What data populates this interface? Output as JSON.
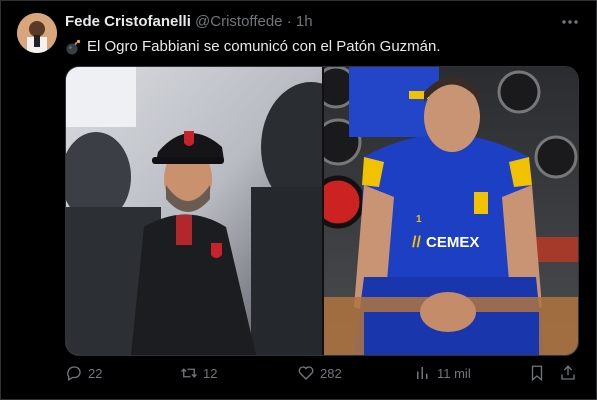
{
  "tweet": {
    "author_name": "Fede Cristofanelli",
    "handle": "@Cristoffede",
    "separator": "·",
    "time": "1h",
    "text": "El Ogro Fabbiani se comunicó con el Patón Guzmán.",
    "emoji_icon": "bomb-icon"
  },
  "media": {
    "left_jersey_text": "",
    "right_sponsor_text": "CEMEX",
    "right_number": "1"
  },
  "actions": {
    "replies": "22",
    "retweets": "12",
    "likes": "282",
    "views": "11 mil"
  },
  "colors": {
    "background": "#000000",
    "text": "#e7e9ea",
    "muted": "#71767b",
    "border": "#2f3336",
    "tigres_blue": "#1d3fc4",
    "tigres_yellow": "#f2c200"
  }
}
